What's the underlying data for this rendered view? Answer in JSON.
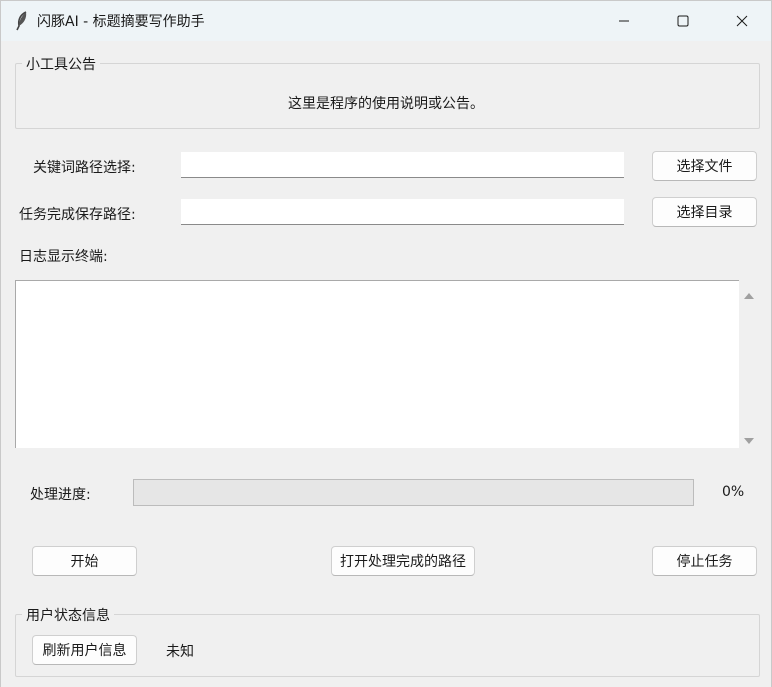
{
  "window": {
    "title": "闪豚AI - 标题摘要写作助手",
    "controls": [
      "minimize",
      "maximize",
      "close"
    ]
  },
  "notice": {
    "group_title": "小工具公告",
    "text": "这里是程序的使用说明或公告。"
  },
  "paths": {
    "keyword_label": "关键词路径选择:",
    "keyword_value": "",
    "keyword_button": "选择文件",
    "save_label": "任务完成保存路径:",
    "save_value": "",
    "save_button": "选择目录"
  },
  "log": {
    "label": "日志显示终端:",
    "content": ""
  },
  "progress": {
    "label": "处理进度:",
    "percent_text": "0%",
    "fraction": 0
  },
  "actions": {
    "start": "开始",
    "open_output": "打开处理完成的路径",
    "stop": "停止任务"
  },
  "user": {
    "group_title": "用户状态信息",
    "refresh_button": "刷新用户信息",
    "status": "未知"
  },
  "icons": {
    "app": "feather-icon",
    "minimize": "minimize-icon",
    "maximize": "maximize-icon",
    "close": "close-icon",
    "scroll_up": "scroll-up-arrow-icon",
    "scroll_down": "scroll-down-arrow-icon"
  }
}
